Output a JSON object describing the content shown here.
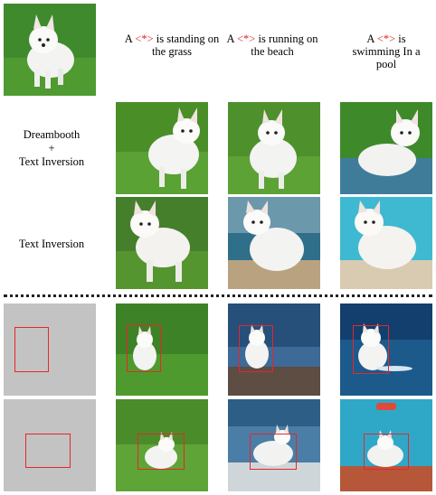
{
  "headers": [
    {
      "pre": "A ",
      "token": "<*>",
      "post": " is standing on the grass"
    },
    {
      "pre": "A ",
      "token": "<*>",
      "post": " is running on the beach"
    },
    {
      "pre": "A ",
      "token": "<*>",
      "post": " is swimming In a pool"
    }
  ],
  "rows": {
    "dreambooth": {
      "line1": "Dreambooth",
      "line2": "+",
      "line3": "Text Inversion"
    },
    "textinversion": {
      "label": "Text Inversion"
    }
  },
  "colors": {
    "token": "#e02020",
    "bbox": "#e8262b",
    "layout_bg": "#c3c3c3",
    "grass": "#4c8f2a",
    "beach_sea": "#3b6e98",
    "pool": "#33b5cf",
    "dog": "#f2f2f0"
  }
}
